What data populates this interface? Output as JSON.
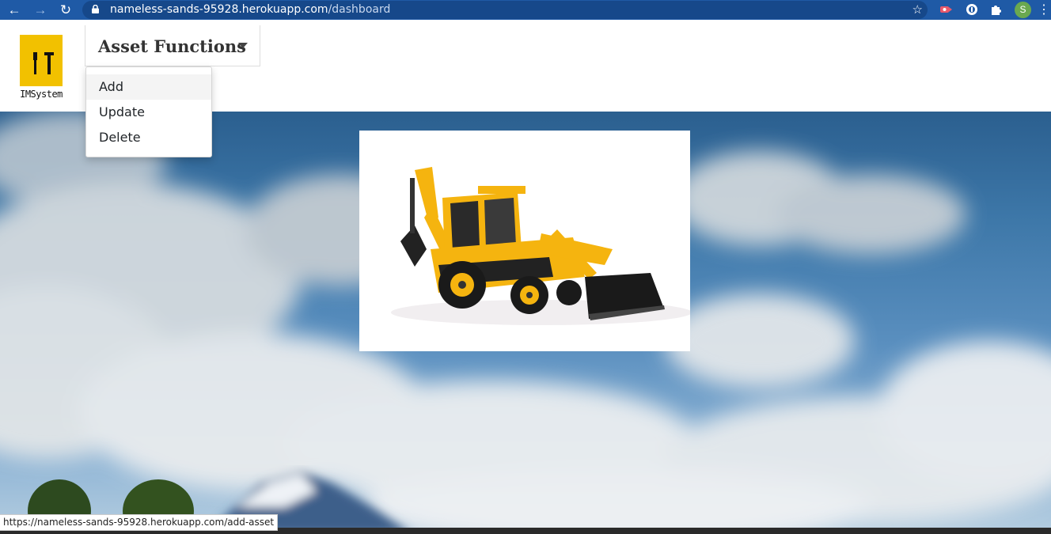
{
  "browser": {
    "url_host": "nameless-sands-95928.herokuapp.com",
    "url_path": "/dashboard",
    "profile_initial": "S"
  },
  "header": {
    "logo_text": "IMSystem",
    "menu_label": "Asset Functions"
  },
  "dropdown": {
    "items": [
      {
        "label": "Add"
      },
      {
        "label": "Update"
      },
      {
        "label": "Delete"
      }
    ]
  },
  "status_bar": {
    "link": "https://nameless-sands-95928.herokuapp.com/add-asset"
  },
  "colors": {
    "browser_bar": "#1f5aa6",
    "logo_bg": "#f2c100",
    "machine_yellow": "#f5b40f"
  },
  "icons": [
    "back-arrow-icon",
    "forward-arrow-icon",
    "reload-icon",
    "lock-icon",
    "star-icon",
    "extension-icon",
    "puzzle-icon",
    "kebab-menu-icon",
    "caret-down-icon",
    "hammer-icon",
    "wrench-icon"
  ]
}
